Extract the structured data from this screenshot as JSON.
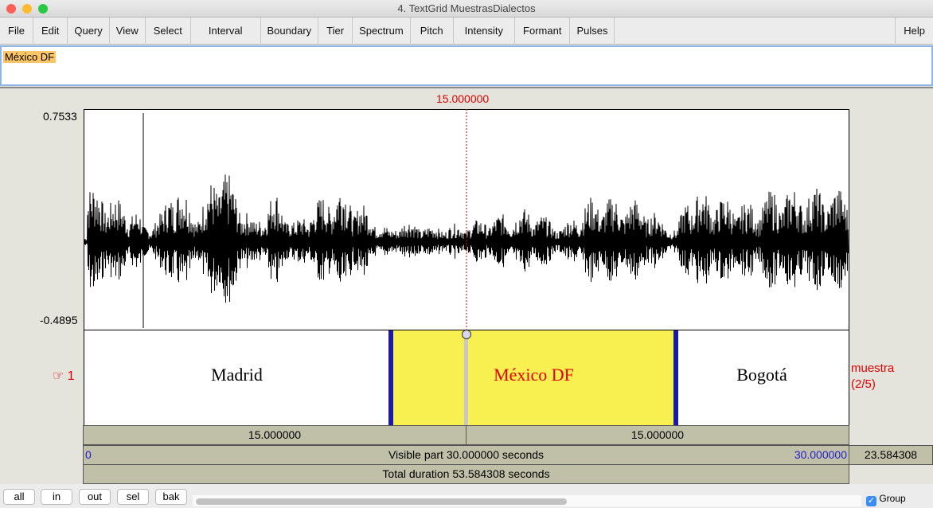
{
  "window": {
    "title": "4. TextGrid MuestrasDialectos"
  },
  "menu": [
    "File",
    "Edit",
    "Query",
    "View",
    "Select",
    "Interval",
    "Boundary",
    "Tier",
    "Spectrum",
    "Pitch",
    "Intensity",
    "Formant",
    "Pulses"
  ],
  "help": "Help",
  "text_field": {
    "value": "México DF"
  },
  "cursor_time": "15.000000",
  "waveform": {
    "ymax": "0.7533",
    "ymin": "-0.4895"
  },
  "tier": {
    "number": "1",
    "pointer_icon": "hand-pointer-icon",
    "name": "muestra",
    "position": "(2/5)",
    "intervals": [
      {
        "label": "Madrid"
      },
      {
        "label": "México DF",
        "selected": true
      },
      {
        "label": "Bogotá"
      }
    ]
  },
  "durations": {
    "left": "15.000000",
    "right": "15.000000"
  },
  "visible": {
    "start": "0",
    "label": "Visible part 30.000000 seconds",
    "end": "30.000000",
    "remaining": "23.584308"
  },
  "total": "Total duration 53.584308 seconds",
  "buttons": [
    "all",
    "in",
    "out",
    "sel",
    "bak"
  ],
  "group": {
    "label": "Group",
    "checked": true
  },
  "colors": {
    "selected_interval": "#f8f050",
    "boundary": "#1a1aa8",
    "cursor": "#e00000",
    "axis_blue": "#2020d0"
  }
}
